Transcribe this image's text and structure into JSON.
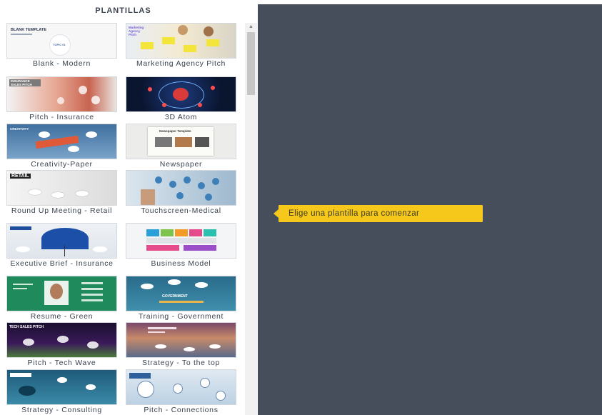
{
  "sidebar": {
    "title": "PLANTILLAS",
    "templates": [
      {
        "label": "Blank - Modern",
        "thumb_text": "BLANK TEMPLATE",
        "thumb_sub": "TOPIC 01"
      },
      {
        "label": "Marketing Agency Pitch",
        "thumb_text": "Marketing Agency Pitch"
      },
      {
        "label": "Pitch - Insurance",
        "thumb_text": "INSURANCE SALES PITCH"
      },
      {
        "label": "3D Atom"
      },
      {
        "label": "Creativity-Paper",
        "thumb_text": "CREATIVITY"
      },
      {
        "label": "Newspaper",
        "thumb_text": "Newspaper Template"
      },
      {
        "label": "Round Up Meeting - Retail",
        "thumb_text": "RETAIL"
      },
      {
        "label": "Touchscreen-Medical"
      },
      {
        "label": "Executive Brief - Insurance"
      },
      {
        "label": "Business Model"
      },
      {
        "label": "Resume - Green"
      },
      {
        "label": "Training - Government",
        "thumb_text": "GOVERNMENT"
      },
      {
        "label": "Pitch - Tech Wave",
        "thumb_text": "TECH SALES PITCH"
      },
      {
        "label": "Strategy - To the top"
      },
      {
        "label": "Strategy - Consulting"
      },
      {
        "label": "Pitch - Connections"
      }
    ]
  },
  "main": {
    "tooltip": "Elige una plantilla para comenzar"
  },
  "colors": {
    "panel_bg": "#464e5b",
    "tooltip_bg": "#f6c81b",
    "text": "#3b4450"
  }
}
